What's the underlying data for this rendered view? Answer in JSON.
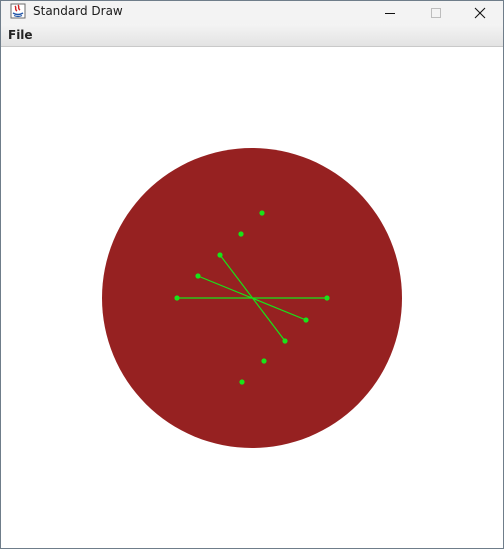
{
  "window": {
    "title": "Standard Draw",
    "app_icon": "java-icon",
    "controls": [
      "minimize-icon",
      "maximize-icon",
      "close-icon"
    ]
  },
  "menubar": {
    "items": [
      {
        "label": "File"
      }
    ]
  },
  "drawing": {
    "background_color": "#ffffff",
    "circle_color": "#962121",
    "point_color": "#19e319",
    "line_color": "#19e319"
  }
}
